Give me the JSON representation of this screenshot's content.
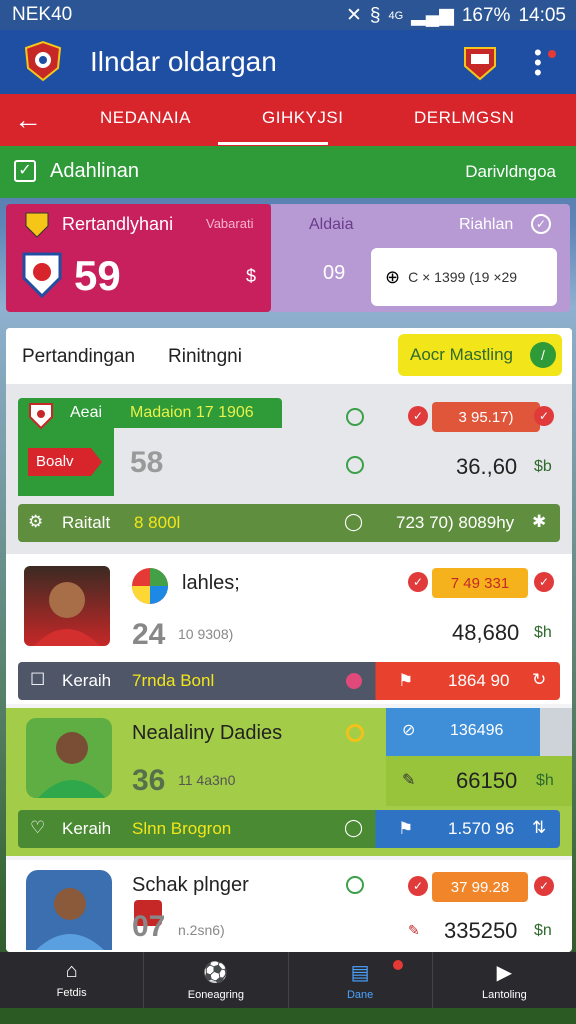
{
  "status": {
    "carrier": "NEK40",
    "battery": "167%",
    "time": "14:05",
    "net": "4G"
  },
  "app": {
    "title": "Ilndar oldargan"
  },
  "tabs": [
    "NEDANAIA",
    "GIHKYJSI",
    "DERLMGSN"
  ],
  "filter": {
    "label": "Adahlinan",
    "right": "Darivldngoa"
  },
  "top_cards": {
    "left_title": "Rertandlyhani",
    "left_sub": "Vabarati",
    "left_score": "59",
    "left_currency": "$",
    "right_label": "Aldaia",
    "right_label2": "Riahlan",
    "right_score": "09",
    "right_box": "C × 1399 (19 ×29"
  },
  "panel": {
    "tab1": "Pertandingan",
    "tab2": "Rinitngni",
    "button": "Aocr Mastling"
  },
  "rows": [
    {
      "team": "Aeai",
      "meta": "Madaion 17 1906",
      "badge": "Boalv",
      "score": "58",
      "pill": "3 95.17)",
      "value": "36.,60",
      "unit": "$b",
      "bar_label": "Raitalt",
      "bar_mid": "8 800l",
      "bar_right": "723 70) 8089hy"
    },
    {
      "name": "lahles;",
      "score": "24",
      "sub": "10 9308)",
      "pill": "7 49 331",
      "value": "48,680",
      "unit": "$h",
      "bar_label": "Keraih",
      "bar_mid": "7rnda Bonl",
      "bar_right": "1864 90"
    },
    {
      "name": "Nealaliny Dadies",
      "score": "36",
      "sub": "11 4a3n0",
      "pill": "136496",
      "value": "66150",
      "unit": "$h",
      "bar_label": "Keraih",
      "bar_mid": "Slnn Brogron",
      "bar_right": "1.570 96"
    },
    {
      "name": "Schak plnger",
      "score": "07",
      "sub": "n.2sn6)",
      "pill": "37 99.28",
      "value": "335250",
      "unit": "$n"
    }
  ],
  "nav": [
    "Fetdis",
    "Eoneagring",
    "Dane",
    "Lantoling"
  ],
  "colors": {
    "primary": "#1f4fa3",
    "red": "#d8242b",
    "green": "#2e9a38",
    "magenta": "#c8205c"
  }
}
